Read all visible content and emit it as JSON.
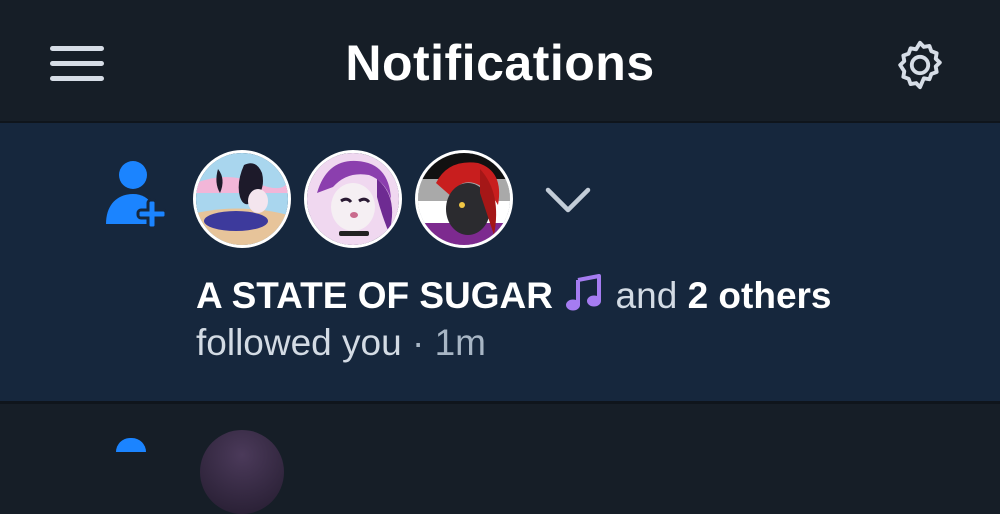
{
  "header": {
    "title": "Notifications",
    "menu_icon": "menu-icon",
    "settings_icon": "gear-icon"
  },
  "notification": {
    "type_icon": "person-add-icon",
    "avatars": [
      {
        "name": "avatar-state-of-sugar"
      },
      {
        "name": "avatar-follower-2"
      },
      {
        "name": "avatar-follower-3"
      }
    ],
    "expand_icon": "chevron-down-icon",
    "actor": "A STATE OF SUGAR",
    "actor_emoji": "🎵",
    "connector": "and",
    "others": "2 others",
    "action": "followed you",
    "separator": "·",
    "time": "1m"
  },
  "colors": {
    "background": "#161e27",
    "card_background": "#16273d",
    "accent": "#1b84ff",
    "text": "#ffffff",
    "muted_text": "#a8b6c5"
  }
}
